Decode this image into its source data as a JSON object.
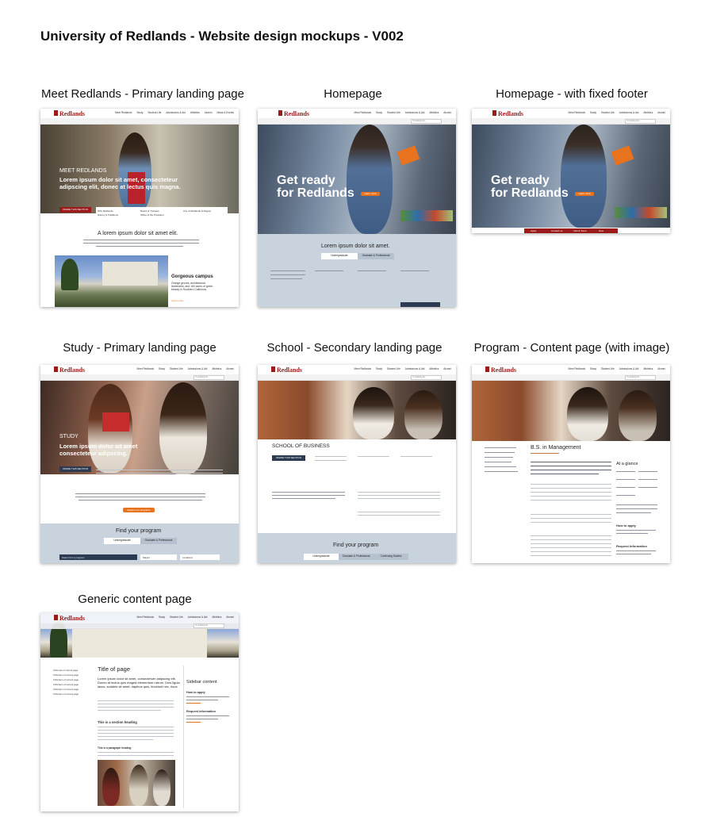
{
  "document": {
    "title": "University of Redlands - Website design mockups - V002"
  },
  "mockups": {
    "meet": {
      "caption": "Meet Redlands - Primary landing page",
      "logo": "Redlands",
      "nav": [
        "Meet Redlands",
        "Study",
        "Student Life",
        "Admissions & Aid",
        "Athletics",
        "Alumni",
        "News & Events"
      ],
      "eyebrow": "MEET REDLANDS",
      "hero_heading": "Lorem ipsum dolor sit amet, consecteteur adipscing elit, donec at lectus quis magna.",
      "section_tab": "INSIDE THIS SECTION",
      "section_links": [
        "Why Redlands",
        "History & Traditions",
        "Board of Trustees",
        "Office of the President",
        "City of Redlands & Region"
      ],
      "intro_heading": "A lorem ipsum dolor sit amet elit.",
      "feature_title": "Gorgeous campus",
      "feature_text": "Orange groves, architectural landmarks, and 160 acres of green beauty in Southern California.",
      "feature_link": "Learn more"
    },
    "home": {
      "caption": "Homepage",
      "logo": "Redlands",
      "hero_heading_1": "Get ready",
      "hero_heading_2": "for Redlands",
      "cta": "Learn more",
      "program_heading": "Lorem ipsum dolor sit amet.",
      "tabs": [
        "Undergraduate",
        "Graduate & Professional"
      ],
      "search_placeholder": "I'm looking for..."
    },
    "home_fixed": {
      "caption": "Homepage - with fixed footer",
      "logo": "Redlands",
      "hero_heading_1": "Get ready",
      "hero_heading_2": "for Redlands",
      "cta": "Learn more",
      "footer_links": [
        "Apply",
        "Contact us",
        "Visit & Tours",
        "Give"
      ]
    },
    "study": {
      "caption": "Study - Primary landing page",
      "logo": "Redlands",
      "eyebrow": "STUDY",
      "hero_heading": "Lorem ipsum dolor sit amet consecteteur adipscing.",
      "section_tab": "INSIDE THIS SECTION",
      "cta": "Explore our programs",
      "find_heading": "Find your program",
      "tabs": [
        "Undergraduate",
        "Graduate & Professional"
      ],
      "search_placeholder": "Search for a program",
      "selects": [
        "Majors",
        "Locations"
      ]
    },
    "school": {
      "caption": "School - Secondary landing page",
      "logo": "Redlands",
      "school_title": "SCHOOL OF BUSINESS",
      "section_tab": "INSIDE THIS SECTION",
      "find_heading": "Find your program",
      "tabs": [
        "Undergraduate",
        "Graduate & Professional",
        "Continuing Studies"
      ]
    },
    "program": {
      "caption": "Program - Content page (with image)",
      "logo": "Redlands",
      "program_title": "B.S. in Management",
      "glance_heading": "At a glance",
      "apply_heading": "How to apply",
      "request_heading": "Request Information"
    },
    "generic": {
      "caption": "Generic content page",
      "logo": "Redlands",
      "page_heading": "Title of page",
      "intro_text": "Lorem ipsum dolor sit amet, consectetuer adipscing elit. Donec at lectus quis magna elementum rutrum. Duis ligula lacus, sodales sit amet, dapibus quis, tincidunt nec, risus.",
      "section_heading": "This is a section heading",
      "paragraph_heading": "This is a paragraph heading",
      "sidebar_heading": "Sidebar content",
      "apply_heading": "How to apply",
      "request_heading": "Request information",
      "side_nav": [
        "Child nav of current page",
        "Child item of current page",
        "Child item of current page",
        "Child item of current page",
        "Child item of current page",
        "Child item of current page"
      ]
    }
  },
  "colors": {
    "brand_red": "#9b1b1b",
    "accent_orange": "#e8731e",
    "navy": "#2c3a52",
    "light_blue_panel": "#c9d3de"
  }
}
